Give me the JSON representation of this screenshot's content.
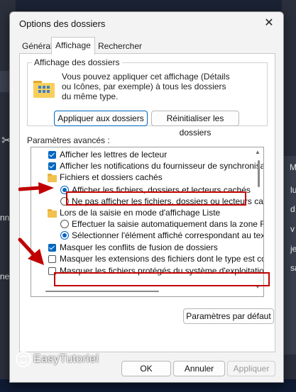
{
  "window": {
    "title": "Options des dossiers",
    "close_glyph": "✕"
  },
  "tabs": [
    {
      "label": "Général"
    },
    {
      "label": "Affichage",
      "active": true
    },
    {
      "label": "Rechercher"
    }
  ],
  "folder_views": {
    "title": "Affichage des dossiers",
    "description": "Vous pouvez appliquer cet affichage (Détails ou Icônes, par exemple) à tous les dossiers du même type.",
    "apply_button": "Appliquer aux dossiers",
    "reset_button": "Réinitialiser les dossiers"
  },
  "advanced": {
    "label": "Paramètres avancés :",
    "items": [
      {
        "type": "checkbox",
        "checked": true,
        "label": "Afficher les lettres de lecteur"
      },
      {
        "type": "checkbox",
        "checked": true,
        "label": "Afficher les notifications du fournisseur de synchronisation"
      },
      {
        "type": "folder",
        "label": "Fichiers et dossiers cachés"
      },
      {
        "type": "radio",
        "checked": true,
        "label": "Afficher les fichiers, dossiers et lecteurs cachés"
      },
      {
        "type": "radio",
        "checked": false,
        "label": "Ne pas afficher les fichiers, dossiers ou lecteurs cachés"
      },
      {
        "type": "folder",
        "label": "Lors de la saisie en mode d'affichage Liste"
      },
      {
        "type": "radio",
        "checked": false,
        "label": "Effectuer la saisie automatiquement dans la zone Rec"
      },
      {
        "type": "radio",
        "checked": true,
        "label": "Sélectionner l'élément affiché correspondant au texte"
      },
      {
        "type": "checkbox",
        "checked": true,
        "label": "Masquer les conflits de fusion de dossiers"
      },
      {
        "type": "checkbox",
        "checked": false,
        "label": "Masquer les extensions des fichiers dont le type est connu"
      },
      {
        "type": "checkbox",
        "checked": false,
        "label": "Masquer les fichiers protégés du système d'exploitation (re"
      }
    ]
  },
  "buttons": {
    "defaults": "Paramètres par défaut",
    "ok": "OK",
    "cancel": "Annuler",
    "apply": "Appliquer"
  },
  "brand": {
    "name": "EasyTutoriel"
  },
  "background": {
    "left_texts": [
      "nne",
      "nent"
    ],
    "right_texts": [
      "M",
      "lu",
      "d",
      "v",
      "je",
      "sa"
    ],
    "scissors_glyph": "✂"
  },
  "colors": {
    "accent": "#0067c0",
    "highlight": "#c00000",
    "desktop": "#1b2233"
  }
}
